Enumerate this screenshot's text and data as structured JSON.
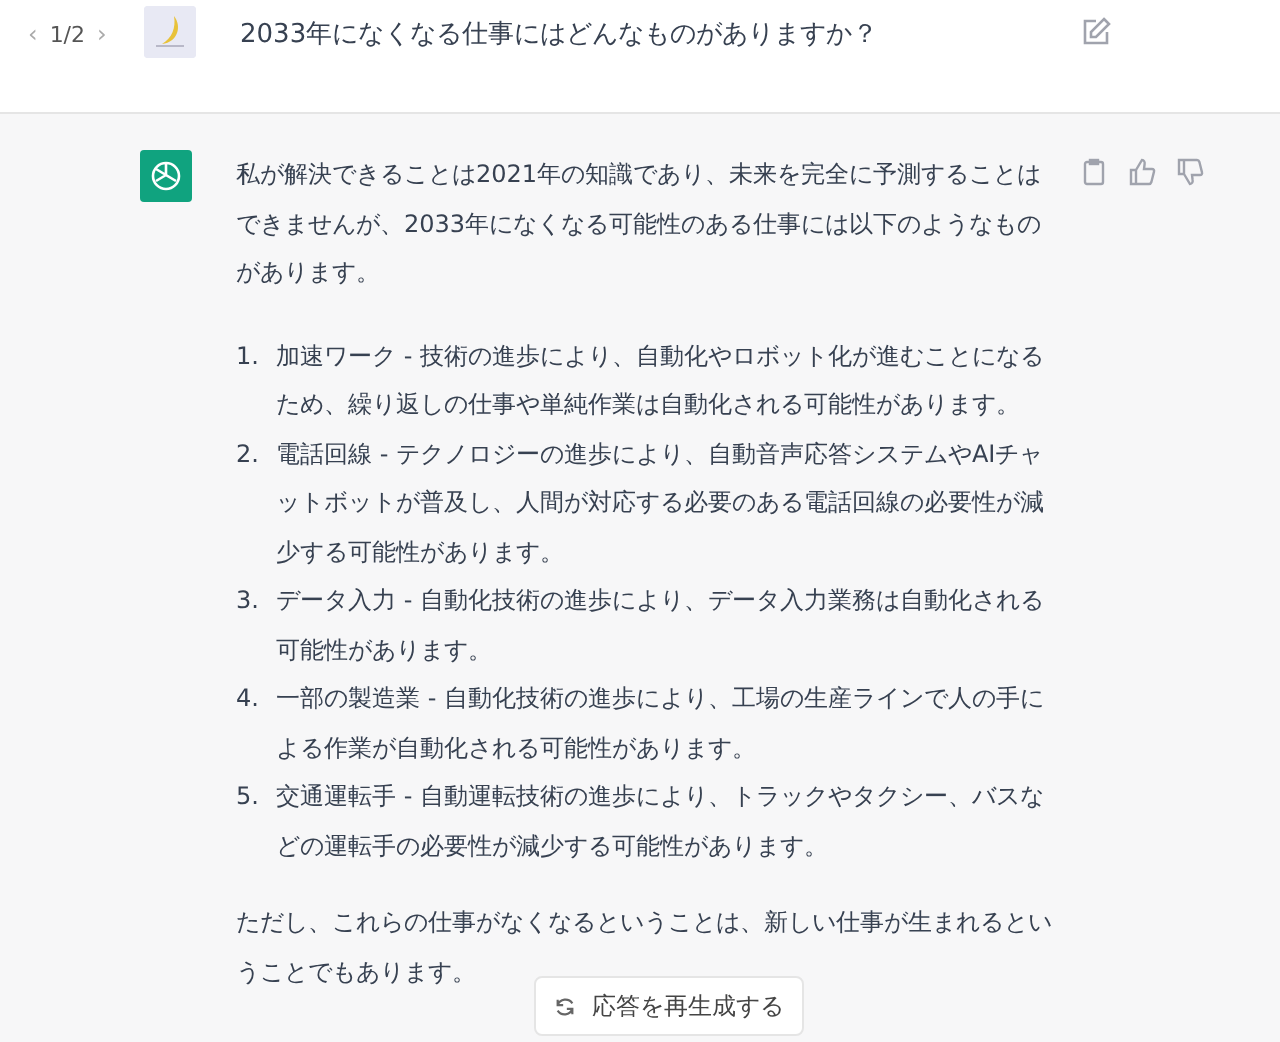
{
  "question": {
    "nav": {
      "prev": "‹",
      "page": "1/2",
      "next": "›"
    },
    "text": "2033年になくなる仕事にはどんなものがありますか？"
  },
  "answer": {
    "intro": "私が解決できることは2021年の知識であり、未来を完全に予測することはできませんが、2033年になくなる可能性のある仕事には以下のようなものがあります。",
    "items": [
      {
        "number": "1.",
        "text": "加速ワーク - 技術の進歩により、自動化やロボット化が進むことになるため、繰り返しの仕事や単純作業は自動化される可能性があります。"
      },
      {
        "number": "2.",
        "text": "電話回線 - テクノロジーの進歩により、自動音声応答システムやAIチャットボットが普及し、人間が対応する必要のある電話回線の必要性が減少する可能性があります。"
      },
      {
        "number": "3.",
        "text": "データ入力 - 自動化技術の進歩により、データ入力業務は自動化される可能性があります。"
      },
      {
        "number": "4.",
        "text": "一部の製造業 - 自動化技術の進歩により、工場の生産ラインで人の手による作業が自動化される可能性があります。"
      },
      {
        "number": "5.",
        "text": "交通運転手 - 自動運転技術の進歩により、トラックやタクシー、バスなどの運転手の必要性が減少する可能性があります。"
      }
    ],
    "outro": "ただし、これらの仕事がなくなるということは、新しい仕事が生まれるということでもあります。"
  },
  "regenerate_button": "応答を再生成する"
}
